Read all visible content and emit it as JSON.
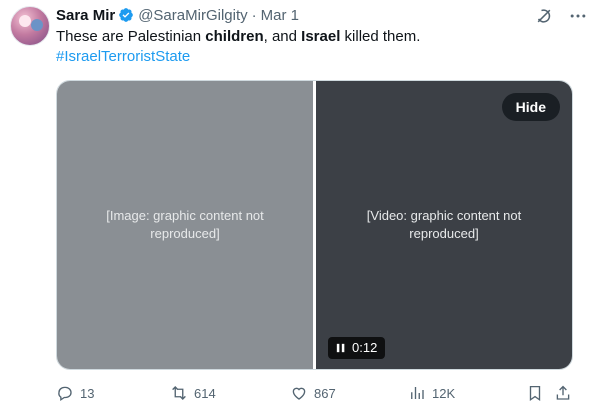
{
  "author": {
    "display_name": "Sara Mir",
    "handle": "@SaraMirGilgity",
    "separator": "·",
    "date": "Mar 1",
    "verified_color": "#1d9bf0"
  },
  "post": {
    "text_parts": [
      "These are Palestinian ",
      "children",
      ", and ",
      "Israel",
      " killed them."
    ],
    "hashtag": "#IsraelTerroristState",
    "hashtag_color": "#1d9bf0"
  },
  "media": {
    "hide_label": "Hide",
    "video_duration": "0:12",
    "left_placeholder": "[Image: graphic content not reproduced]",
    "right_placeholder": "[Video: graphic content not reproduced]"
  },
  "actions": {
    "replies": "13",
    "reposts": "614",
    "likes": "867",
    "views": "12K"
  },
  "icons": {
    "top": [
      "grok-icon",
      "more-icon"
    ],
    "actions": [
      "reply-icon",
      "repost-icon",
      "like-icon",
      "views-icon",
      "bookmark-icon",
      "share-icon"
    ]
  }
}
